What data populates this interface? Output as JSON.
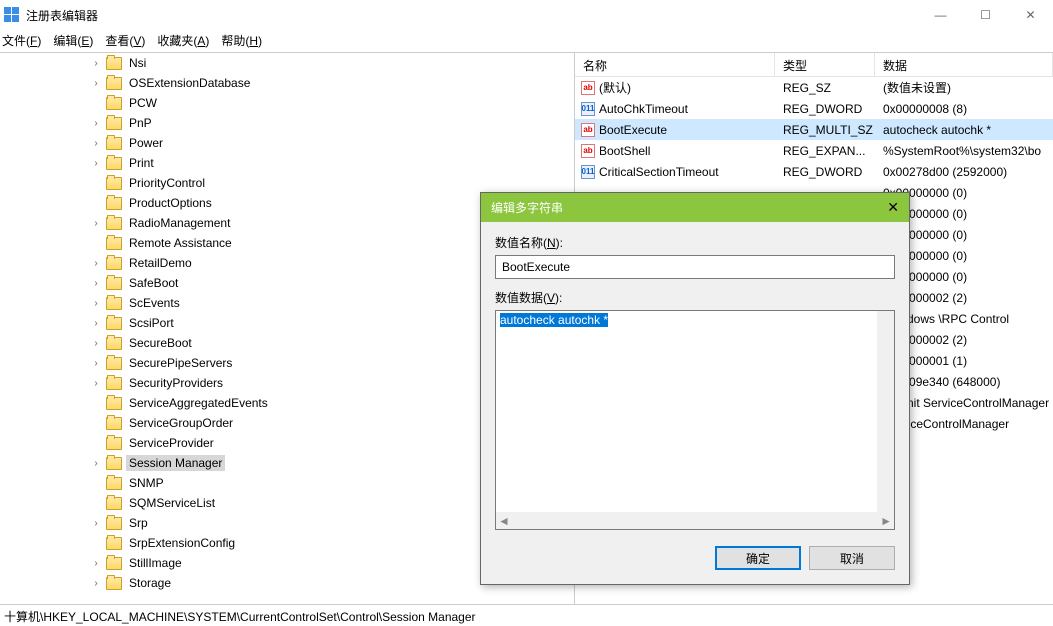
{
  "window": {
    "title": "注册表编辑器",
    "min": "—",
    "max": "☐",
    "close": "✕"
  },
  "menu": {
    "file": "文件(F)",
    "edit": "编辑(E)",
    "view": "查看(V)",
    "favorites": "收藏夹(A)",
    "help": "帮助(H)"
  },
  "tree": [
    {
      "indent": 5,
      "chev": "›",
      "label": "Nsi"
    },
    {
      "indent": 5,
      "chev": "›",
      "label": "OSExtensionDatabase"
    },
    {
      "indent": 5,
      "chev": "",
      "label": "PCW"
    },
    {
      "indent": 5,
      "chev": "›",
      "label": "PnP"
    },
    {
      "indent": 5,
      "chev": "›",
      "label": "Power"
    },
    {
      "indent": 5,
      "chev": "›",
      "label": "Print"
    },
    {
      "indent": 5,
      "chev": "",
      "label": "PriorityControl"
    },
    {
      "indent": 5,
      "chev": "",
      "label": "ProductOptions"
    },
    {
      "indent": 5,
      "chev": "›",
      "label": "RadioManagement"
    },
    {
      "indent": 5,
      "chev": "",
      "label": "Remote Assistance"
    },
    {
      "indent": 5,
      "chev": "›",
      "label": "RetailDemo"
    },
    {
      "indent": 5,
      "chev": "›",
      "label": "SafeBoot"
    },
    {
      "indent": 5,
      "chev": "›",
      "label": "ScEvents"
    },
    {
      "indent": 5,
      "chev": "›",
      "label": "ScsiPort"
    },
    {
      "indent": 5,
      "chev": "›",
      "label": "SecureBoot"
    },
    {
      "indent": 5,
      "chev": "›",
      "label": "SecurePipeServers"
    },
    {
      "indent": 5,
      "chev": "›",
      "label": "SecurityProviders"
    },
    {
      "indent": 5,
      "chev": "",
      "label": "ServiceAggregatedEvents"
    },
    {
      "indent": 5,
      "chev": "",
      "label": "ServiceGroupOrder"
    },
    {
      "indent": 5,
      "chev": "",
      "label": "ServiceProvider"
    },
    {
      "indent": 5,
      "chev": "›",
      "label": "Session Manager",
      "selected": true
    },
    {
      "indent": 5,
      "chev": "",
      "label": "SNMP"
    },
    {
      "indent": 5,
      "chev": "",
      "label": "SQMServiceList"
    },
    {
      "indent": 5,
      "chev": "›",
      "label": "Srp"
    },
    {
      "indent": 5,
      "chev": "",
      "label": "SrpExtensionConfig"
    },
    {
      "indent": 5,
      "chev": "›",
      "label": "StillImage"
    },
    {
      "indent": 5,
      "chev": "›",
      "label": "Storage"
    }
  ],
  "list": {
    "headers": {
      "name": "名称",
      "type": "类型",
      "data": "数据"
    },
    "rows": [
      {
        "icon": "str",
        "name": "(默认)",
        "type": "REG_SZ",
        "data": "(数值未设置)"
      },
      {
        "icon": "num",
        "name": "AutoChkTimeout",
        "type": "REG_DWORD",
        "data": "0x00000008 (8)"
      },
      {
        "icon": "str",
        "name": "BootExecute",
        "type": "REG_MULTI_SZ",
        "data": "autocheck autochk *",
        "selected": true
      },
      {
        "icon": "str",
        "name": "BootShell",
        "type": "REG_EXPAN...",
        "data": "%SystemRoot%\\system32\\bo"
      },
      {
        "icon": "num",
        "name": "CriticalSectionTimeout",
        "type": "REG_DWORD",
        "data": "0x00278d00 (2592000)"
      },
      {
        "icon": "",
        "name": "",
        "type": "",
        "data": "0x00000000 (0)"
      },
      {
        "icon": "",
        "name": "",
        "type": "",
        "data": "0x00000000 (0)"
      },
      {
        "icon": "",
        "name": "",
        "type": "",
        "data": "0x00000000 (0)"
      },
      {
        "icon": "",
        "name": "",
        "type": "",
        "data": "0x00000000 (0)"
      },
      {
        "icon": "",
        "name": "",
        "type": "",
        "data": "0x00000000 (0)"
      },
      {
        "icon": "",
        "name": "",
        "type": "",
        "data": "0x00000002 (2)"
      },
      {
        "icon": "",
        "name": "",
        "type": "",
        "data": "\\Windows \\RPC Control"
      },
      {
        "icon": "",
        "name": "",
        "type": "",
        "data": "0x00000002 (2)"
      },
      {
        "icon": "",
        "name": "",
        "type": "",
        "data": "0x00000001 (1)"
      },
      {
        "icon": "",
        "name": "",
        "type": "",
        "data": "0x0009e340 (648000)"
      },
      {
        "icon": "",
        "name": "",
        "type": "",
        "data": "WinInit ServiceControlManager"
      },
      {
        "icon": "",
        "name": "",
        "type": "",
        "data": "ServiceControlManager"
      }
    ]
  },
  "statusbar": "十算机\\HKEY_LOCAL_MACHINE\\SYSTEM\\CurrentControlSet\\Control\\Session Manager",
  "dialog": {
    "title": "编辑多字符串",
    "name_label": "数值名称(N):",
    "name_value": "BootExecute",
    "data_label": "数值数据(V):",
    "data_value": "autocheck autochk *",
    "ok": "确定",
    "cancel": "取消"
  }
}
